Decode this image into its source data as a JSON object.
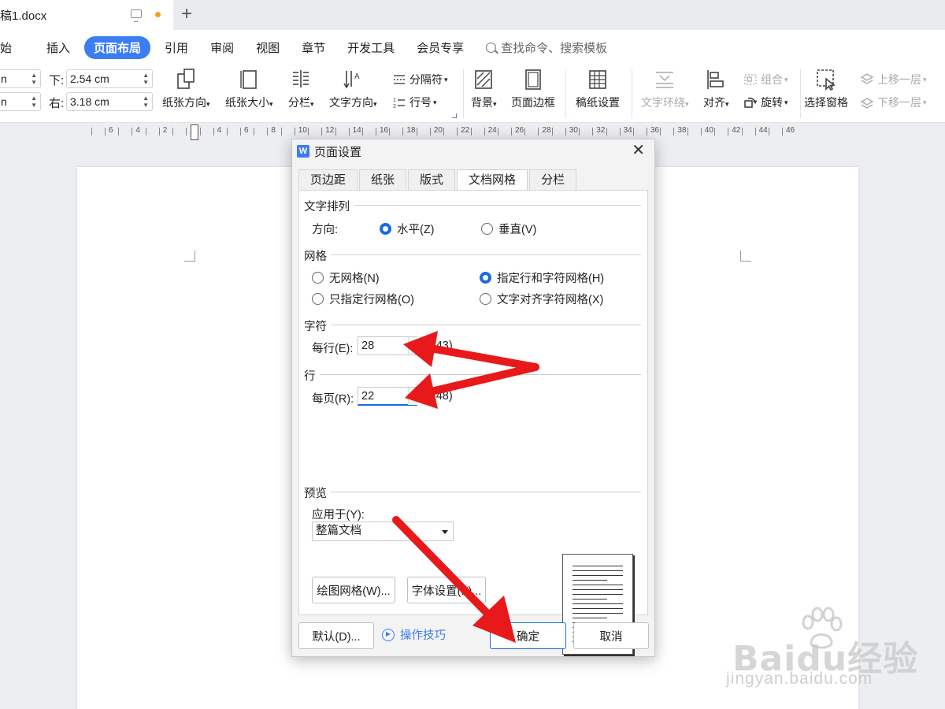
{
  "titlebar": {
    "doc_title": "稿1.docx",
    "new_tab": "+"
  },
  "menu": {
    "items": [
      "始",
      "插入",
      "页面布局",
      "引用",
      "审阅",
      "视图",
      "章节",
      "开发工具",
      "会员专享"
    ],
    "active": "页面布局",
    "search_text": "查找命令、搜索模板"
  },
  "ribbon": {
    "margin_left_top": "n",
    "margin_left_bottom": "n",
    "bottom_label": "下:",
    "bottom_value": "2.54 cm",
    "right_label": "右:",
    "right_value": "3.18 cm",
    "paper_orientation": "纸张方向",
    "paper_size": "纸张大小",
    "columns": "分栏",
    "text_direction": "文字方向",
    "separator": "分隔符",
    "line_number": "行号",
    "background": "背景",
    "page_border": "页面边框",
    "manuscript": "稿纸设置",
    "text_wrap": "文字环绕",
    "align": "对齐",
    "group": "组合",
    "rotate": "旋转",
    "selection_pane": "选择窗格",
    "bring_forward": "上移一层",
    "send_backward": "下移一层"
  },
  "ruler": {
    "numbers": [
      "6",
      "4",
      "2",
      "2",
      "4",
      "6",
      "8",
      "10",
      "12",
      "14",
      "16",
      "18",
      "20",
      "22",
      "24",
      "26",
      "28",
      "30",
      "32",
      "34",
      "36",
      "38",
      "40",
      "42",
      "44",
      "46"
    ]
  },
  "dialog": {
    "title": "页面设置",
    "close": "✕",
    "tabs": [
      "页边距",
      "纸张",
      "版式",
      "文档网格",
      "分栏"
    ],
    "active_tab": "文档网格",
    "text_arrangement": {
      "group_label": "文字排列",
      "direction_label": "方向:",
      "horizontal": "水平(Z)",
      "vertical": "垂直(V)",
      "selected": "水平(Z)"
    },
    "grid": {
      "group_label": "网格",
      "no_grid": "无网格(N)",
      "line_grid_only": "只指定行网格(O)",
      "line_and_char_grid": "指定行和字符网格(H)",
      "text_snap_char_grid": "文字对齐字符网格(X)",
      "selected": "指定行和字符网格(H)"
    },
    "chars": {
      "group_label": "字符",
      "per_line_label": "每行(E):",
      "per_line_value": "28",
      "range": "(1-43)"
    },
    "lines": {
      "group_label": "行",
      "per_page_label": "每页(R):",
      "per_page_value": "22",
      "range": "(1-48)"
    },
    "preview": {
      "group_label": "预览",
      "apply_to_label": "应用于(Y):",
      "apply_to_value": "整篇文档"
    },
    "draw_grid_button": "绘图网格(W)...",
    "font_settings_button": "字体设置(F)...",
    "default_button": "默认(D)...",
    "tips_link": "操作技巧",
    "ok_button": "确定",
    "cancel_button": "取消"
  },
  "watermark": {
    "brand": "Baidu经验",
    "url": "jingyan.baidu.com"
  },
  "colors": {
    "accent": "#3c7df4",
    "arrow": "#e8191b",
    "radio_checked": "#1a6ae0"
  }
}
